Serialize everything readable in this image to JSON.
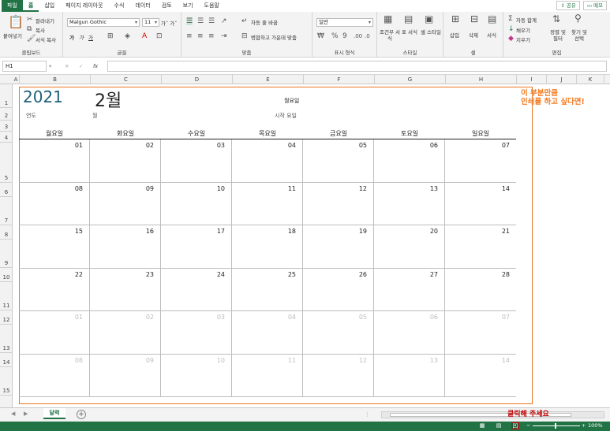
{
  "ribbon_tabs": [
    "파일",
    "홈",
    "삽입",
    "페이지 레이아웃",
    "수식",
    "데이터",
    "검토",
    "보기",
    "도움말"
  ],
  "top_buttons": {
    "share": "공유",
    "comments": "메모"
  },
  "clipboard": {
    "paste": "붙여넣기",
    "cut": "잘라내기",
    "copy": "복사",
    "format_painter": "서식 복사",
    "label": "클립보드"
  },
  "font": {
    "name": "Malgun Gothic",
    "size": "11",
    "bold": "가",
    "italic": "가",
    "underline": "가",
    "label": "글꼴"
  },
  "alignment": {
    "wrap": "자동 줄 바꿈",
    "merge": "병합하고 가운데 맞춤",
    "label": "맞춤"
  },
  "number": {
    "format": "일반",
    "label": "표시 형식"
  },
  "styles": {
    "conditional": "조건부 서식",
    "table": "표 서식",
    "cell": "셀 스타일",
    "label": "스타일"
  },
  "cells": {
    "insert": "삽입",
    "delete": "삭제",
    "format": "서식",
    "label": "셀"
  },
  "editing": {
    "autosum": "자동 합계",
    "fill": "채우기",
    "clear": "지우기",
    "sort": "정렬 및 필터",
    "find": "찾기 및 선택",
    "label": "편집"
  },
  "formula_bar": {
    "name_box": "H1",
    "content": ""
  },
  "columns": [
    "A",
    "B",
    "C",
    "D",
    "E",
    "F",
    "G",
    "H",
    "I",
    "J",
    "K"
  ],
  "rows": [
    "1",
    "2",
    "3",
    "4",
    "5",
    "6",
    "7",
    "8",
    "9",
    "10",
    "11",
    "12",
    "13",
    "14",
    "15"
  ],
  "calendar": {
    "year": "2021",
    "month": "2월",
    "start_day": "월요일",
    "label_year": "연도",
    "label_month": "월",
    "label_start": "시작 요일",
    "weekdays": [
      "월요일",
      "화요일",
      "수요일",
      "목요일",
      "금요일",
      "토요일",
      "일요일"
    ],
    "weeks": [
      [
        {
          "d": "01",
          "g": false
        },
        {
          "d": "02",
          "g": false
        },
        {
          "d": "03",
          "g": false
        },
        {
          "d": "04",
          "g": false
        },
        {
          "d": "05",
          "g": false
        },
        {
          "d": "06",
          "g": false
        },
        {
          "d": "07",
          "g": false
        }
      ],
      [
        {
          "d": "08",
          "g": false
        },
        {
          "d": "09",
          "g": false
        },
        {
          "d": "10",
          "g": false
        },
        {
          "d": "11",
          "g": false
        },
        {
          "d": "12",
          "g": false
        },
        {
          "d": "13",
          "g": false
        },
        {
          "d": "14",
          "g": false
        }
      ],
      [
        {
          "d": "15",
          "g": false
        },
        {
          "d": "16",
          "g": false
        },
        {
          "d": "17",
          "g": false
        },
        {
          "d": "18",
          "g": false
        },
        {
          "d": "19",
          "g": false
        },
        {
          "d": "20",
          "g": false
        },
        {
          "d": "21",
          "g": false
        }
      ],
      [
        {
          "d": "22",
          "g": false
        },
        {
          "d": "23",
          "g": false
        },
        {
          "d": "24",
          "g": false
        },
        {
          "d": "25",
          "g": false
        },
        {
          "d": "26",
          "g": false
        },
        {
          "d": "27",
          "g": false
        },
        {
          "d": "28",
          "g": false
        }
      ],
      [
        {
          "d": "01",
          "g": true
        },
        {
          "d": "02",
          "g": true
        },
        {
          "d": "03",
          "g": true
        },
        {
          "d": "04",
          "g": true
        },
        {
          "d": "05",
          "g": true
        },
        {
          "d": "06",
          "g": true
        },
        {
          "d": "07",
          "g": true
        }
      ],
      [
        {
          "d": "08",
          "g": true
        },
        {
          "d": "09",
          "g": true
        },
        {
          "d": "10",
          "g": true
        },
        {
          "d": "11",
          "g": true
        },
        {
          "d": "12",
          "g": true
        },
        {
          "d": "13",
          "g": true
        },
        {
          "d": "14",
          "g": true
        }
      ]
    ]
  },
  "annotation": {
    "line1": "이 부분만큼",
    "line2": "인쇄를 하고 싶다면!"
  },
  "click_message": "클릭해 주세요",
  "sheet_tab": "달력",
  "zoom": "100%",
  "colors": {
    "accent": "#217346",
    "print_border": "#e87722",
    "note": "#f47a20",
    "click": "#c00000"
  }
}
